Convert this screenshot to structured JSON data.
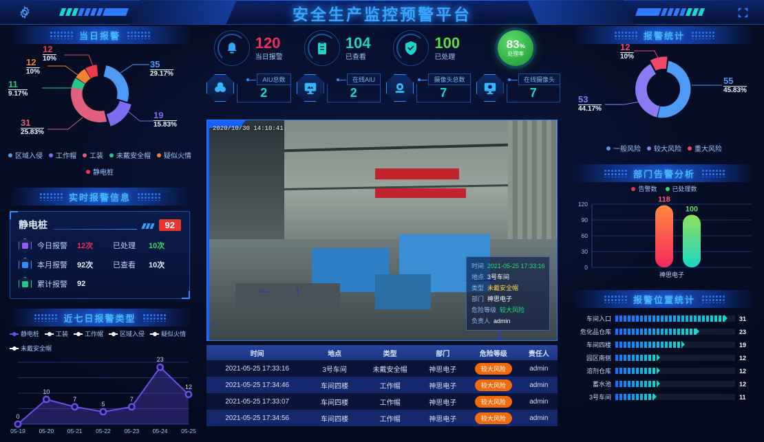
{
  "header": {
    "title": "安全生产监控预警平台",
    "gear_icon": "gear-icon",
    "fullscreen_icon": "fullscreen-icon"
  },
  "kpi": {
    "cards": [
      {
        "value": "120",
        "label": "当日报警",
        "color": "#ef2c5c",
        "icon": "alarm-bell-icon"
      },
      {
        "value": "104",
        "label": "已查看",
        "color": "#19d6c8",
        "icon": "clipboard-icon"
      },
      {
        "value": "100",
        "label": "已处理",
        "color": "#5ddb4b",
        "icon": "shield-check-icon"
      }
    ],
    "gauge": {
      "value": "83",
      "unit": "%",
      "label": "处理率",
      "percent": 83,
      "color": "#35c94f"
    },
    "devices": [
      {
        "caption": "AIU总数",
        "value": "2",
        "icon": "aiu-cube-icon"
      },
      {
        "caption": "在线AIU",
        "value": "2",
        "icon": "aiu-monitor-icon"
      },
      {
        "caption": "摄像头总数",
        "value": "7",
        "icon": "camera-icon"
      },
      {
        "caption": "在线摄像头",
        "value": "7",
        "icon": "camera-monitor-icon"
      }
    ]
  },
  "today_alarm": {
    "title": "当日报警",
    "chart_data": {
      "type": "pie",
      "title": "当日报警",
      "categories": [
        "区域入侵",
        "工作帽",
        "工装",
        "未戴安全帽",
        "疑似火情",
        "静电桩"
      ],
      "values": [
        35,
        19,
        31,
        11,
        12,
        12
      ],
      "percents": [
        "29.17%",
        "15.83%",
        "25.83%",
        "9.17%",
        "10%",
        "10%"
      ],
      "colors": [
        "#4e9bf5",
        "#7b6cf0",
        "#e0607e",
        "#22c98a",
        "#f2822d",
        "#ef3b4e"
      ],
      "legend_position": "bottom"
    }
  },
  "realtime": {
    "title": "实时报警信息",
    "name": "静电桩",
    "badge": "92",
    "rows": [
      {
        "label": "今日报警",
        "value": "12次",
        "value_color": "#ef2c5c",
        "label2": "已处理",
        "value2": "10次",
        "value2_color": "#3ddc6a",
        "icon": "alarm-hex-icon"
      },
      {
        "label": "本月报警",
        "value": "92次",
        "value_color": "#e8f1ff",
        "label2": "已查看",
        "value2": "10次",
        "value2_color": "#e8f1ff",
        "icon": "grid-hex-icon"
      },
      {
        "label": "累计报警",
        "value": "92",
        "value_color": "#e8f1ff",
        "label2": "",
        "value2": "",
        "value2_color": "#e8f1ff",
        "icon": "stack-hex-icon"
      }
    ]
  },
  "seven_day": {
    "title": "近七日报警类型",
    "chart_data": {
      "type": "line",
      "title": "近七日报警类型",
      "categories": [
        "05-19",
        "05-20",
        "05-21",
        "05-22",
        "05-23",
        "05-24",
        "05-25"
      ],
      "series": [
        {
          "name": "静电桩",
          "values": [
            0,
            10,
            7,
            5,
            7,
            23,
            12
          ],
          "color": "#6a4ff0"
        }
      ],
      "legend": [
        "静电桩",
        "工装",
        "工作帽",
        "区域入侵",
        "疑似火情",
        "未戴安全帽"
      ],
      "legend_colors": [
        "#6a4ff0",
        "#ffffff",
        "#ffffff",
        "#ffffff",
        "#ffffff",
        "#ffffff"
      ],
      "ylim": [
        0,
        25
      ],
      "xlabel": "",
      "ylabel": "",
      "grid": true
    }
  },
  "video": {
    "timestamp": "2020/10/30   14:10:41",
    "info": {
      "rows": [
        {
          "key": "时间",
          "value": "2021-05-25 17:33:16",
          "style": "hl"
        },
        {
          "key": "地点",
          "value": "3号车间",
          "style": ""
        },
        {
          "key": "类型",
          "value": "未戴安全帽",
          "style": "warn"
        },
        {
          "key": "部门",
          "value": "神思电子",
          "style": ""
        },
        {
          "key": "危险等级",
          "value": "较大风险",
          "style": "hl"
        },
        {
          "key": "负责人",
          "value": "admin",
          "style": ""
        }
      ]
    }
  },
  "table": {
    "columns": [
      "时间",
      "地点",
      "类型",
      "部门",
      "危险等级",
      "责任人"
    ],
    "rows": [
      {
        "time": "2021-05-25 17:33:16",
        "place": "3号车间",
        "type": "未戴安全帽",
        "dept": "神思电子",
        "risk": "较大风险",
        "owner": "admin"
      },
      {
        "time": "2021-05-25 17:34:46",
        "place": "车间四楼",
        "type": "工作帽",
        "dept": "神思电子",
        "risk": "较大风险",
        "owner": "admin"
      },
      {
        "time": "2021-05-25 17:33:07",
        "place": "车间四楼",
        "type": "工作帽",
        "dept": "神思电子",
        "risk": "较大风险",
        "owner": "admin"
      },
      {
        "time": "2021-05-25 17:34:56",
        "place": "车间四楼",
        "type": "工作帽",
        "dept": "神思电子",
        "risk": "较大风险",
        "owner": "admin"
      }
    ]
  },
  "alarm_stats": {
    "title": "报警统计",
    "chart_data": {
      "type": "pie",
      "title": "报警统计",
      "categories": [
        "一般风险",
        "较大风险",
        "重大风险"
      ],
      "values": [
        55,
        53,
        12
      ],
      "percents": [
        "45.83%",
        "44.17%",
        "10%"
      ],
      "colors": [
        "#4e9bf5",
        "#8a7bf2",
        "#f0486b"
      ],
      "legend_position": "bottom"
    }
  },
  "dept_analysis": {
    "title": "部门告警分析",
    "chart_data": {
      "type": "bar",
      "title": "部门告警分析",
      "categories": [
        "神思电子"
      ],
      "series": [
        {
          "name": "告警数",
          "values": [
            118
          ],
          "color": "#ef2c5c"
        },
        {
          "name": "已处理数",
          "values": [
            100
          ],
          "color": "#3ddc6a"
        }
      ],
      "yticks": [
        "0",
        "30",
        "60",
        "90",
        "120"
      ],
      "ylim": [
        0,
        120
      ],
      "xlabel": "",
      "ylabel": "",
      "grid": true,
      "legend_position": "top"
    }
  },
  "position_stats": {
    "title": "报警位置统计",
    "chart_data": {
      "type": "bar",
      "title": "报警位置统计",
      "orientation": "horizontal",
      "categories": [
        "车间入口",
        "危化品仓库",
        "车间四楼",
        "园区南侧",
        "溶剂仓库",
        "蓄水池",
        "3号车间"
      ],
      "values": [
        31,
        23,
        19,
        12,
        12,
        12,
        11
      ],
      "max": 34,
      "colors": [
        "#1f6bff",
        "#19d6c8"
      ]
    }
  }
}
